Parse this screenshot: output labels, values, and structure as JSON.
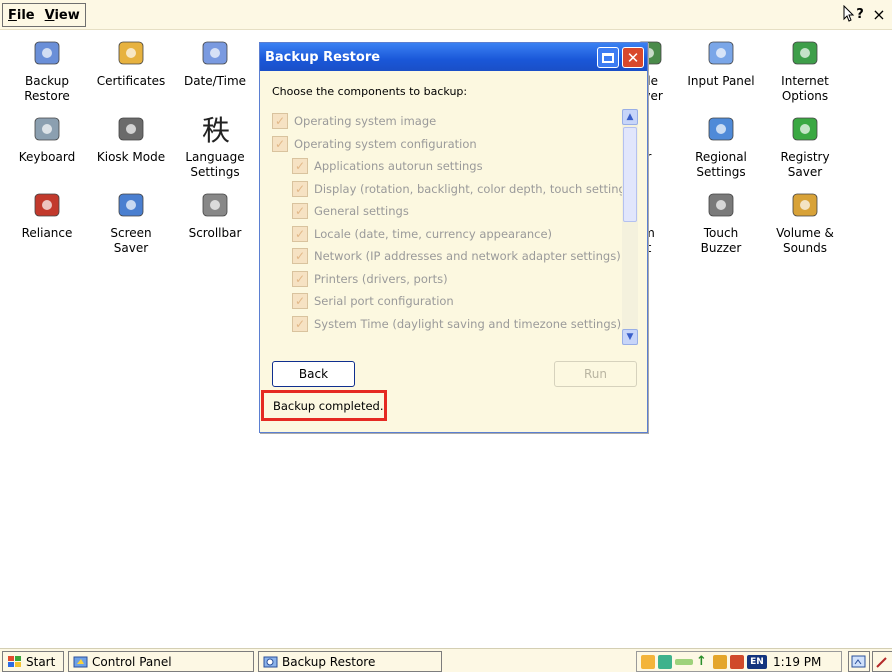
{
  "menu": {
    "file_prefix": "F",
    "file_rest": "ile",
    "view_prefix": "V",
    "view_rest": "iew"
  },
  "window_controls": {
    "help": "?",
    "close": "×"
  },
  "desktop_icons": [
    {
      "label": "Backup\nRestore",
      "icon": "backup-restore-icon"
    },
    {
      "label": "Certificates",
      "icon": "certificates-icon"
    },
    {
      "label": "Date/Time",
      "icon": "datetime-icon"
    },
    {
      "label": "ale\nriver",
      "icon": "driver-icon"
    },
    {
      "label": "Input Panel",
      "icon": "input-panel-icon"
    },
    {
      "label": "Internet\nOptions",
      "icon": "internet-options-icon"
    },
    {
      "label": "Keyboard",
      "icon": "keyboard-icon"
    },
    {
      "label": "Kiosk Mode",
      "icon": "kiosk-mode-icon"
    },
    {
      "label": "Language\nSettings",
      "icon": "language-settings-icon"
    },
    {
      "label": "r",
      "icon": "hidden-icon"
    },
    {
      "label": "Regional\nSettings",
      "icon": "regional-settings-icon"
    },
    {
      "label": "Registry\nSaver",
      "icon": "registry-saver-icon"
    },
    {
      "label": "Reliance",
      "icon": "reliance-icon"
    },
    {
      "label": "Screen\nSaver",
      "icon": "screen-saver-icon"
    },
    {
      "label": "Scrollbar",
      "icon": "scrollbar-icon"
    },
    {
      "label": "m\nt",
      "icon": "hidden-icon"
    },
    {
      "label": "Touch\nBuzzer",
      "icon": "touch-buzzer-icon"
    },
    {
      "label": "Volume &\nSounds",
      "icon": "volume-sounds-icon"
    }
  ],
  "dialog": {
    "title": "Backup Restore",
    "prompt": "Choose the components to backup:",
    "items": [
      "Operating system image",
      "Operating system configuration",
      "Applications autorun settings",
      "Display (rotation, backlight, color depth, touch settings)",
      "General settings",
      "Locale (date, time, currency appearance)",
      "Network (IP addresses and network adapter settings)",
      "Printers (drivers, ports)",
      "Serial port configuration",
      "System Time (daylight saving and timezone settings)"
    ],
    "back_label": "Back",
    "run_label": "Run",
    "status": "Backup completed."
  },
  "taskbar": {
    "start": "Start",
    "control_panel": "Control Panel",
    "backup_restore": "Backup Restore",
    "clock": "1:19 PM",
    "lang": "EN"
  }
}
